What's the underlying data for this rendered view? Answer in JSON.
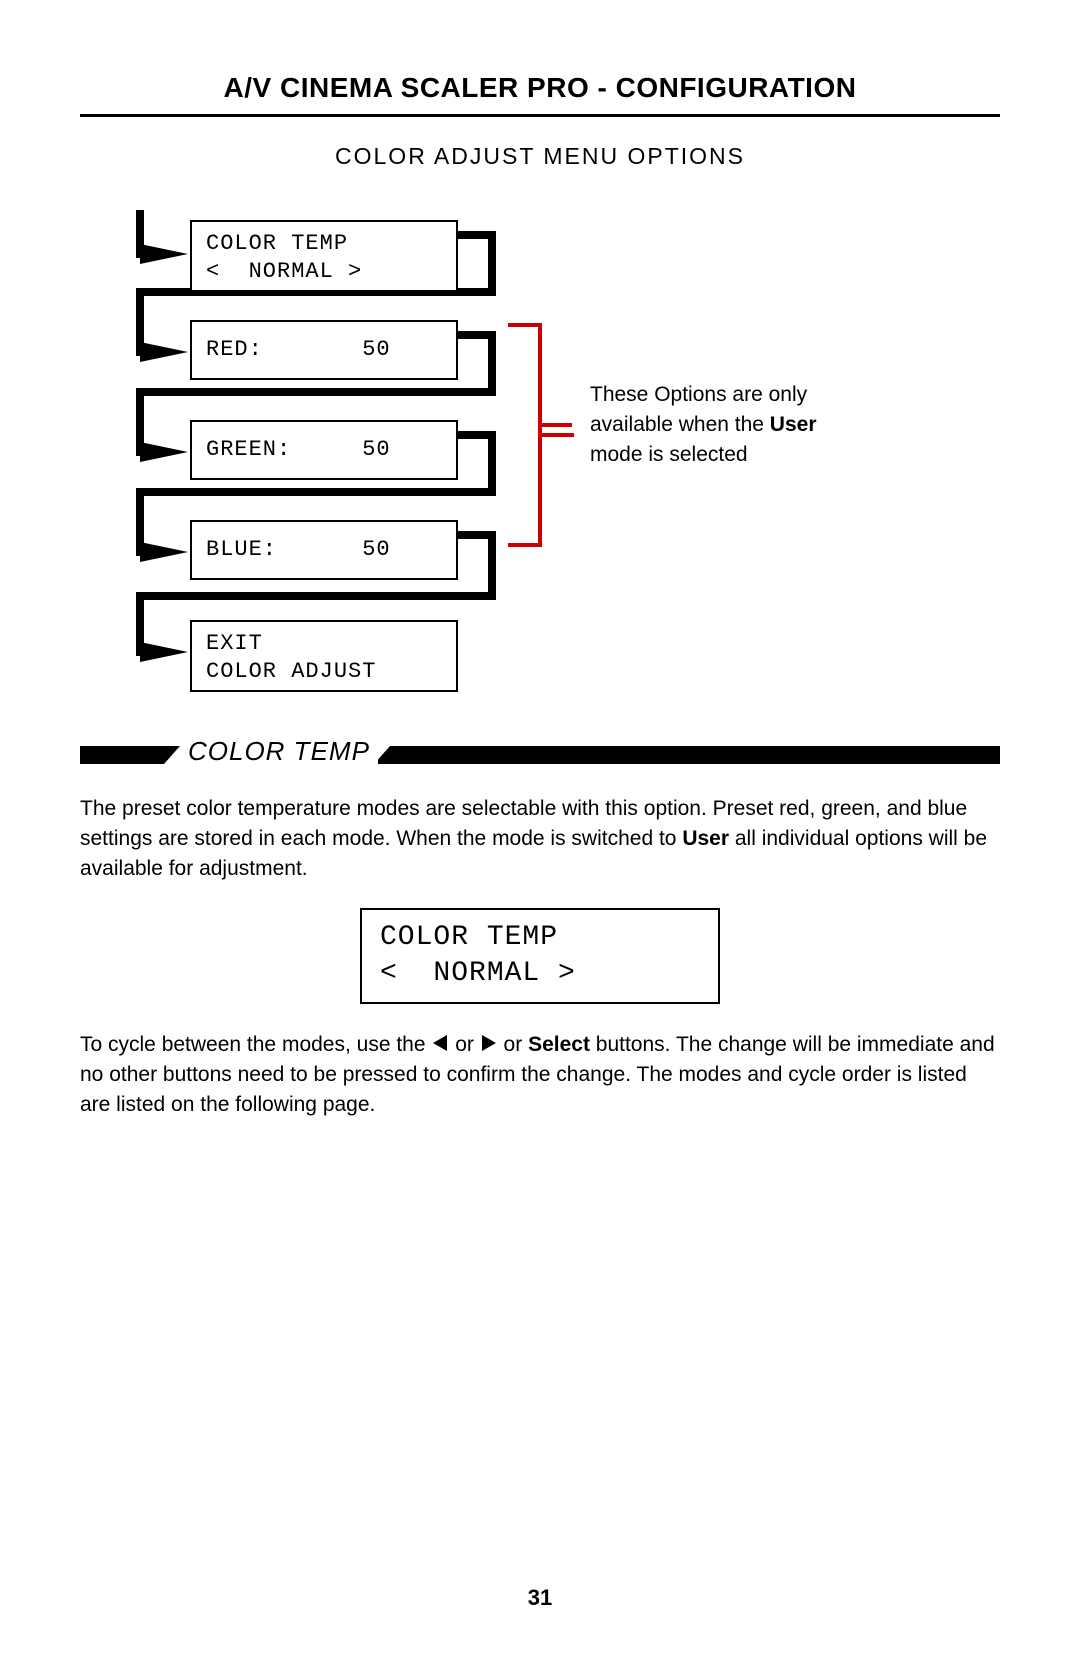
{
  "title": "A/V CINEMA SCALER PRO - CONFIGURATION",
  "subtitle": "COLOR ADJUST MENU OPTIONS",
  "menu": {
    "box1_line1": "COLOR TEMP",
    "box1_line2": "<  NORMAL >",
    "box2": "RED:       50",
    "box3": "GREEN:     50",
    "box4": "BLUE:      50",
    "box5_line1": "EXIT",
    "box5_line2": "COLOR ADJUST"
  },
  "note_pre": "These Options are only available when the ",
  "note_bold": "User",
  "note_post": " mode is selected",
  "section_heading": "COLOR TEMP",
  "para1_pre": "The preset color temperature modes are selectable with this option. Preset red, green, and blue settings are stored in each mode. When the mode is switched to ",
  "para1_bold": "User",
  "para1_post": " all individual options will be available for adjustment.",
  "lcd2_line1": "COLOR TEMP",
  "lcd2_line2": "<  NORMAL >",
  "para2_a": "To cycle between the modes, use the ",
  "para2_b": " or ",
  "para2_c": " or ",
  "para2_bold": "Select",
  "para2_d": " buttons. The change will be immediate and no other buttons need to be pressed to confirm the change. The modes and cycle order is listed are listed on the following page.",
  "page_number": "31"
}
